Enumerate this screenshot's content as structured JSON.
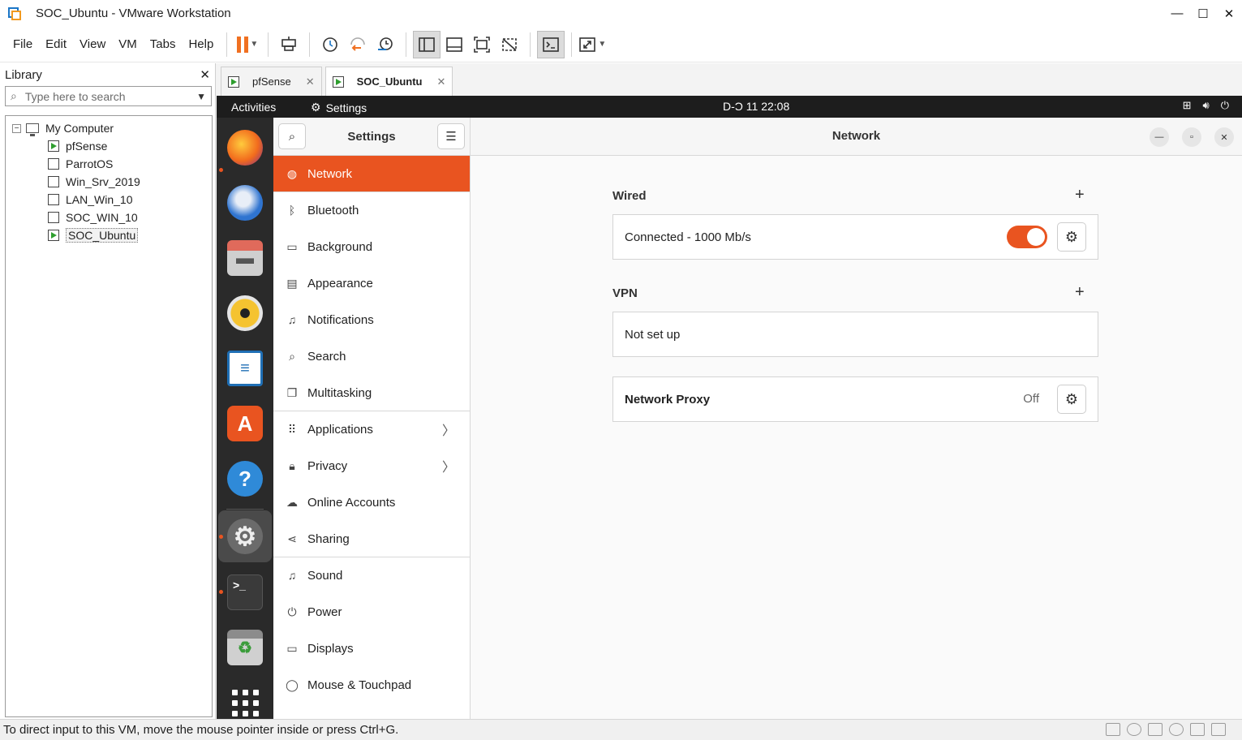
{
  "window": {
    "title": "SOC_Ubuntu - VMware Workstation",
    "minimize": "—",
    "maximize": "☐",
    "close": "✕"
  },
  "menu": [
    "File",
    "Edit",
    "View",
    "VM",
    "Tabs",
    "Help"
  ],
  "library": {
    "title": "Library",
    "close": "✕",
    "search_placeholder": "Type here to search",
    "root": "My Computer",
    "vms": [
      "pfSense",
      "ParrotOS",
      "Win_Srv_2019",
      "LAN_Win_10",
      "SOC_WIN_10",
      "SOC_Ubuntu"
    ]
  },
  "tabs": [
    {
      "label": "pfSense",
      "close": "✕"
    },
    {
      "label": "SOC_Ubuntu",
      "close": "✕"
    }
  ],
  "guest": {
    "topbar": {
      "activities": "Activities",
      "app": "Settings",
      "clock": "D-Ɔ 11  22:08"
    },
    "sidebar": {
      "title": "Settings",
      "items": [
        {
          "label": "Network",
          "icon": "globe-icon",
          "glyph": "◍"
        },
        {
          "label": "Bluetooth",
          "icon": "bluetooth-icon",
          "glyph": "ᛒ"
        },
        {
          "label": "Background",
          "icon": "background-icon",
          "glyph": "▭"
        },
        {
          "label": "Appearance",
          "icon": "appearance-icon",
          "glyph": "▤"
        },
        {
          "label": "Notifications",
          "icon": "bell-icon",
          "glyph": "♫"
        },
        {
          "label": "Search",
          "icon": "search-icon",
          "glyph": "⌕"
        },
        {
          "label": "Multitasking",
          "icon": "multitasking-icon",
          "glyph": "❐"
        },
        {
          "label": "Applications",
          "icon": "apps-grid-icon",
          "glyph": "⠿"
        },
        {
          "label": "Privacy",
          "icon": "lock-icon",
          "glyph": "🔒︎"
        },
        {
          "label": "Online Accounts",
          "icon": "cloud-icon",
          "glyph": "☁"
        },
        {
          "label": "Sharing",
          "icon": "share-icon",
          "glyph": "⋖"
        },
        {
          "label": "Sound",
          "icon": "music-note-icon",
          "glyph": "♫"
        },
        {
          "label": "Power",
          "icon": "power-icon",
          "glyph": "⏻"
        },
        {
          "label": "Displays",
          "icon": "display-icon",
          "glyph": "▭"
        },
        {
          "label": "Mouse & Touchpad",
          "icon": "mouse-icon",
          "glyph": "◯"
        }
      ]
    },
    "content": {
      "title": "Network",
      "wired": {
        "label": "Wired",
        "status": "Connected - 1000 Mb/s",
        "enabled": true
      },
      "vpn": {
        "label": "VPN",
        "status": "Not set up"
      },
      "proxy": {
        "label": "Network Proxy",
        "status": "Off"
      }
    }
  },
  "statusbar": {
    "message": "To direct input to this VM, move the mouse pointer inside or press Ctrl+G."
  },
  "colors": {
    "accent": "#e95420",
    "dock": "#2a2a2a",
    "topbar": "#1d1d1d",
    "pause": "#f07021"
  }
}
